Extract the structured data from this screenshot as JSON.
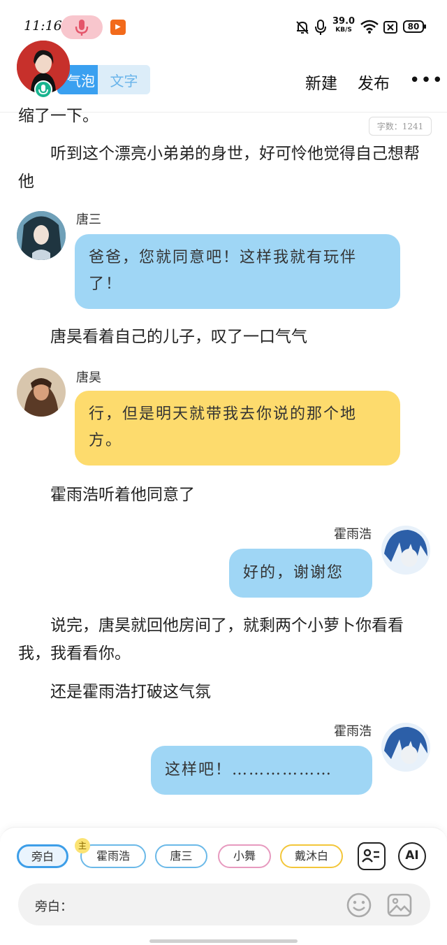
{
  "status_bar": {
    "time": "11:16",
    "speed_value": "39.0",
    "speed_unit": "KB/S",
    "battery": "80"
  },
  "header": {
    "tab_bubble": "气泡",
    "tab_text": "文字",
    "new_label": "新建",
    "publish_label": "发布",
    "more_label": "•••"
  },
  "word_count": "字数：1241",
  "story": {
    "top_fragment": "缩了一下。",
    "para1": "听到这个漂亮小弟弟的身世，好可怜他觉得自己想帮他",
    "msg1": {
      "name": "唐三",
      "text": "爸爸，您就同意吧！这样我就有玩伴了！"
    },
    "para2": "唐昊看着自己的儿子，叹了一口气气",
    "msg2": {
      "name": "唐昊",
      "text": "行，但是明天就带我去你说的那个地方。"
    },
    "para3": "霍雨浩听着他同意了",
    "msg3": {
      "name": "霍雨浩",
      "text": "好的，谢谢您"
    },
    "para4": "说完，唐昊就回他房间了，就剩两个小萝卜你看看我，我看看你。",
    "para5": "还是霍雨浩打破这气氛",
    "msg4": {
      "name": "霍雨浩",
      "text": "这样吧！………………"
    }
  },
  "roles": {
    "chip_narration": "旁白",
    "chip_main_badge": "主",
    "chip_hyh": "霍雨浩",
    "chip_ts": "唐三",
    "chip_xw": "小舞",
    "chip_dmb": "戴沐白",
    "ai_label": "AI"
  },
  "input": {
    "label": "旁白："
  },
  "colors": {
    "accent_blue": "#3aa0f0",
    "bubble_blue": "#9fd6f5",
    "bubble_yellow": "#fddb6d"
  }
}
